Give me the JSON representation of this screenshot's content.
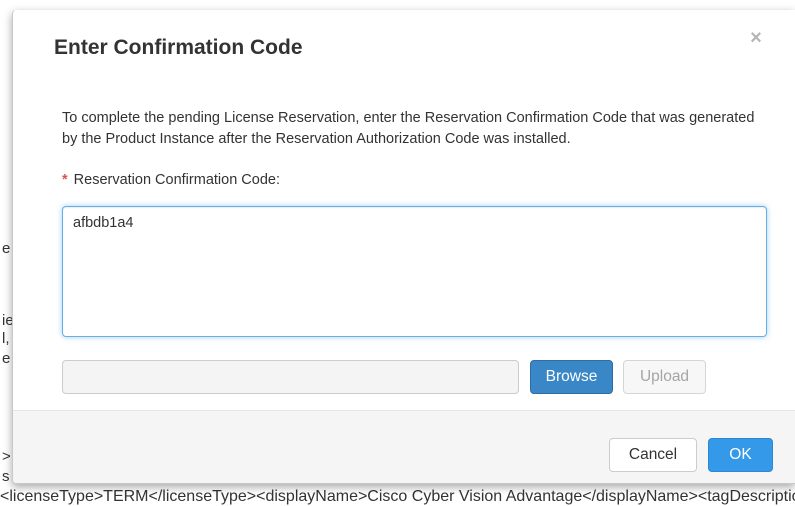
{
  "background": {
    "fragments": [
      "e",
      "ie",
      "l,",
      "e",
      ">",
      "s",
      "<licenseType>TERM</licenseType><displayName>Cisco Cyber Vision Advantage</displayName><tagDescription"
    ]
  },
  "modal": {
    "title": "Enter Confirmation Code",
    "close_glyph": "×",
    "description": "To complete the pending License Reservation, enter the Reservation Confirmation Code that was generated by the Product Instance after the Reservation Authorization Code was installed.",
    "field_required_mark": "*",
    "field_label": "Reservation Confirmation Code:",
    "code_value": "afbdb1a4",
    "file_path": "",
    "browse_label": "Browse",
    "upload_label": "Upload"
  },
  "footer": {
    "cancel_label": "Cancel",
    "ok_label": "OK"
  },
  "colors": {
    "primary": "#3399e8",
    "browse": "#3a87c8",
    "required": "#d9534f"
  }
}
